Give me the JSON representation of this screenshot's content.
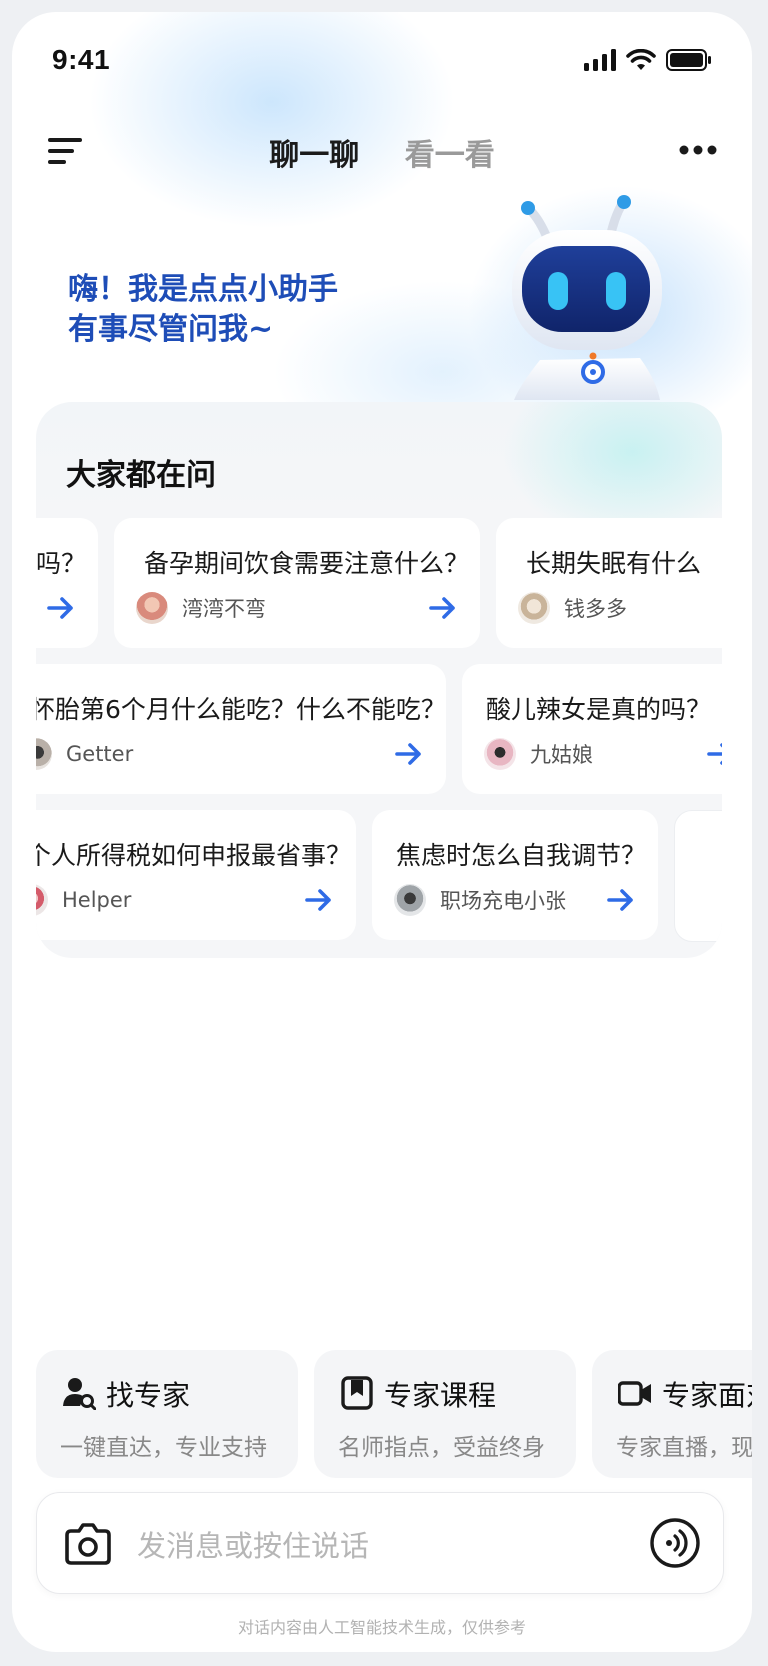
{
  "status_bar": {
    "time": "9:41"
  },
  "header": {
    "tabs": [
      {
        "label": "聊一聊",
        "active": true
      },
      {
        "label": "看一看",
        "active": false
      }
    ]
  },
  "greeting": {
    "line1": "嗨！我是点点小助手",
    "line2": "有事尽管问我~"
  },
  "popular": {
    "title": "大家都在问",
    "rows": [
      [
        {
          "question": "吗？",
          "user": ""
        },
        {
          "question": "备孕期间饮食需要注意什么？",
          "user": "湾湾不弯"
        },
        {
          "question": "长期失眠有什么",
          "user": "钱多多"
        }
      ],
      [
        {
          "question": "怀胎第6个月什么能吃？什么不能吃？",
          "user": "Getter"
        },
        {
          "question": "酸儿辣女是真的吗？",
          "user": "九姑娘"
        }
      ],
      [
        {
          "question": "个人所得税如何申报最省事？",
          "user": "Helper"
        },
        {
          "question": "焦虑时怎么自我调节？",
          "user": "职场充电小张"
        },
        {
          "question": "",
          "user": ""
        }
      ]
    ]
  },
  "features": [
    {
      "title": "找专家",
      "subtitle": "一键直达，专业支持",
      "icon": "expert-search-icon"
    },
    {
      "title": "专家课程",
      "subtitle": "名师指点，受益终身",
      "icon": "course-book-icon"
    },
    {
      "title": "专家面对面",
      "subtitle": "专家直播，现场答疑",
      "icon": "video-camera-icon"
    }
  ],
  "input": {
    "placeholder": "发消息或按住说话"
  },
  "disclaimer": "对话内容由人工智能技术生成，仅供参考",
  "colors": {
    "accent": "#2f6be6",
    "greeting": "#1e4db7"
  }
}
